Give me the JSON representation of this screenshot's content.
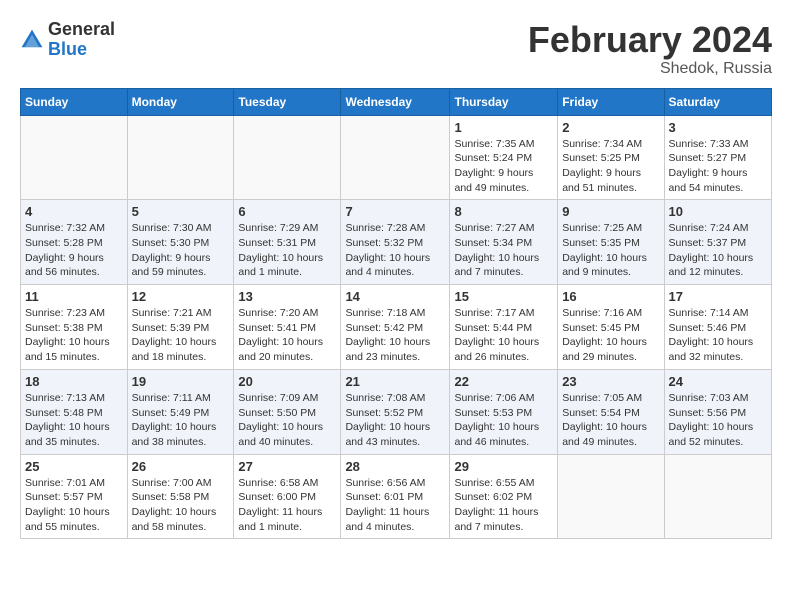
{
  "header": {
    "logo_general": "General",
    "logo_blue": "Blue",
    "month_year": "February 2024",
    "location": "Shedok, Russia"
  },
  "weekdays": [
    "Sunday",
    "Monday",
    "Tuesday",
    "Wednesday",
    "Thursday",
    "Friday",
    "Saturday"
  ],
  "weeks": [
    [
      {
        "day": "",
        "info": ""
      },
      {
        "day": "",
        "info": ""
      },
      {
        "day": "",
        "info": ""
      },
      {
        "day": "",
        "info": ""
      },
      {
        "day": "1",
        "info": "Sunrise: 7:35 AM\nSunset: 5:24 PM\nDaylight: 9 hours\nand 49 minutes."
      },
      {
        "day": "2",
        "info": "Sunrise: 7:34 AM\nSunset: 5:25 PM\nDaylight: 9 hours\nand 51 minutes."
      },
      {
        "day": "3",
        "info": "Sunrise: 7:33 AM\nSunset: 5:27 PM\nDaylight: 9 hours\nand 54 minutes."
      }
    ],
    [
      {
        "day": "4",
        "info": "Sunrise: 7:32 AM\nSunset: 5:28 PM\nDaylight: 9 hours\nand 56 minutes."
      },
      {
        "day": "5",
        "info": "Sunrise: 7:30 AM\nSunset: 5:30 PM\nDaylight: 9 hours\nand 59 minutes."
      },
      {
        "day": "6",
        "info": "Sunrise: 7:29 AM\nSunset: 5:31 PM\nDaylight: 10 hours\nand 1 minute."
      },
      {
        "day": "7",
        "info": "Sunrise: 7:28 AM\nSunset: 5:32 PM\nDaylight: 10 hours\nand 4 minutes."
      },
      {
        "day": "8",
        "info": "Sunrise: 7:27 AM\nSunset: 5:34 PM\nDaylight: 10 hours\nand 7 minutes."
      },
      {
        "day": "9",
        "info": "Sunrise: 7:25 AM\nSunset: 5:35 PM\nDaylight: 10 hours\nand 9 minutes."
      },
      {
        "day": "10",
        "info": "Sunrise: 7:24 AM\nSunset: 5:37 PM\nDaylight: 10 hours\nand 12 minutes."
      }
    ],
    [
      {
        "day": "11",
        "info": "Sunrise: 7:23 AM\nSunset: 5:38 PM\nDaylight: 10 hours\nand 15 minutes."
      },
      {
        "day": "12",
        "info": "Sunrise: 7:21 AM\nSunset: 5:39 PM\nDaylight: 10 hours\nand 18 minutes."
      },
      {
        "day": "13",
        "info": "Sunrise: 7:20 AM\nSunset: 5:41 PM\nDaylight: 10 hours\nand 20 minutes."
      },
      {
        "day": "14",
        "info": "Sunrise: 7:18 AM\nSunset: 5:42 PM\nDaylight: 10 hours\nand 23 minutes."
      },
      {
        "day": "15",
        "info": "Sunrise: 7:17 AM\nSunset: 5:44 PM\nDaylight: 10 hours\nand 26 minutes."
      },
      {
        "day": "16",
        "info": "Sunrise: 7:16 AM\nSunset: 5:45 PM\nDaylight: 10 hours\nand 29 minutes."
      },
      {
        "day": "17",
        "info": "Sunrise: 7:14 AM\nSunset: 5:46 PM\nDaylight: 10 hours\nand 32 minutes."
      }
    ],
    [
      {
        "day": "18",
        "info": "Sunrise: 7:13 AM\nSunset: 5:48 PM\nDaylight: 10 hours\nand 35 minutes."
      },
      {
        "day": "19",
        "info": "Sunrise: 7:11 AM\nSunset: 5:49 PM\nDaylight: 10 hours\nand 38 minutes."
      },
      {
        "day": "20",
        "info": "Sunrise: 7:09 AM\nSunset: 5:50 PM\nDaylight: 10 hours\nand 40 minutes."
      },
      {
        "day": "21",
        "info": "Sunrise: 7:08 AM\nSunset: 5:52 PM\nDaylight: 10 hours\nand 43 minutes."
      },
      {
        "day": "22",
        "info": "Sunrise: 7:06 AM\nSunset: 5:53 PM\nDaylight: 10 hours\nand 46 minutes."
      },
      {
        "day": "23",
        "info": "Sunrise: 7:05 AM\nSunset: 5:54 PM\nDaylight: 10 hours\nand 49 minutes."
      },
      {
        "day": "24",
        "info": "Sunrise: 7:03 AM\nSunset: 5:56 PM\nDaylight: 10 hours\nand 52 minutes."
      }
    ],
    [
      {
        "day": "25",
        "info": "Sunrise: 7:01 AM\nSunset: 5:57 PM\nDaylight: 10 hours\nand 55 minutes."
      },
      {
        "day": "26",
        "info": "Sunrise: 7:00 AM\nSunset: 5:58 PM\nDaylight: 10 hours\nand 58 minutes."
      },
      {
        "day": "27",
        "info": "Sunrise: 6:58 AM\nSunset: 6:00 PM\nDaylight: 11 hours\nand 1 minute."
      },
      {
        "day": "28",
        "info": "Sunrise: 6:56 AM\nSunset: 6:01 PM\nDaylight: 11 hours\nand 4 minutes."
      },
      {
        "day": "29",
        "info": "Sunrise: 6:55 AM\nSunset: 6:02 PM\nDaylight: 11 hours\nand 7 minutes."
      },
      {
        "day": "",
        "info": ""
      },
      {
        "day": "",
        "info": ""
      }
    ]
  ]
}
